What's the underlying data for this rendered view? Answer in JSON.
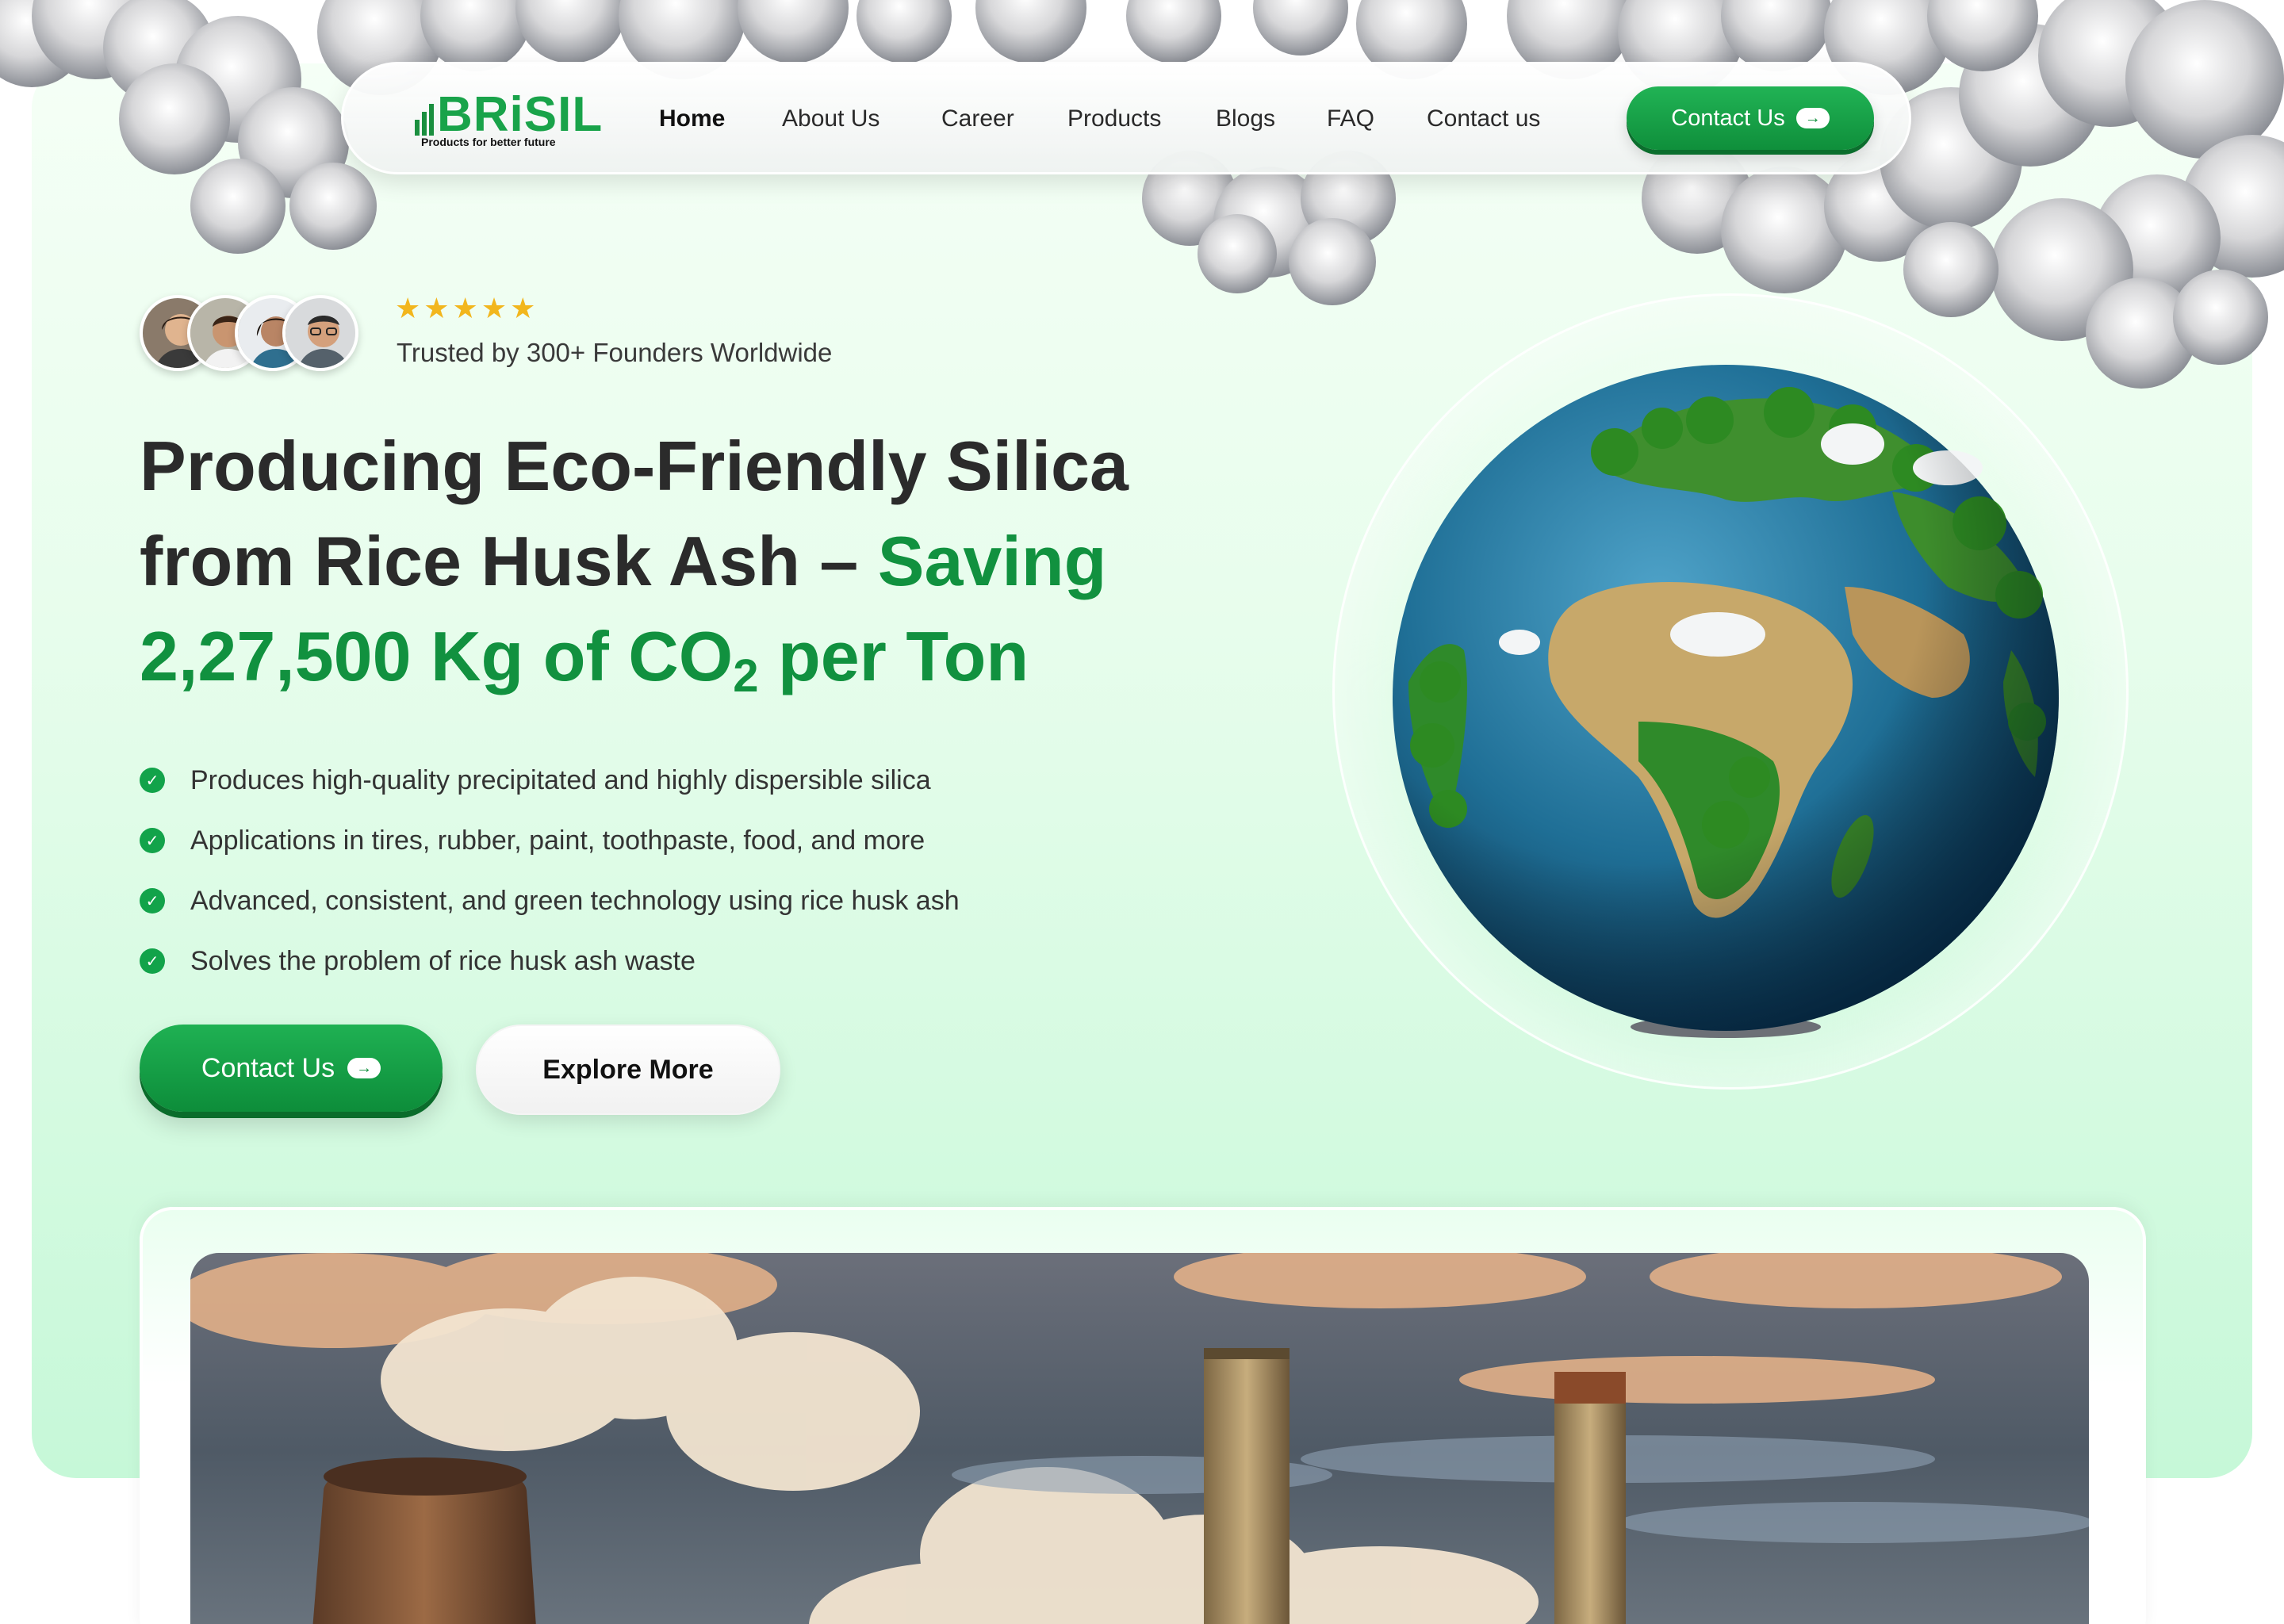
{
  "nav": {
    "logo_text": "BRiSIL",
    "logo_tagline": "Products for better future",
    "links": [
      "Home",
      "About Us",
      "Career",
      "Products",
      "Blogs",
      "FAQ",
      "Contact us"
    ],
    "active": "Home",
    "cta_label": "Contact Us",
    "cta_arrow": "→"
  },
  "trust": {
    "stars": "★★★★★",
    "rating": 5,
    "text": "Trusted by 300+ Founders Worldwide"
  },
  "headline": {
    "line1": "Producing Eco-Friendly Silica",
    "line2_dark": "from Rice Husk Ash –",
    "line2_green": "Saving",
    "line3_green_a": "2,27,500 Kg of CO",
    "line3_sub": "2",
    "line3_green_b": "per Ton"
  },
  "features": [
    "Produces high-quality precipitated and highly dispersible silica",
    "Applications in tires, rubber, paint, toothpaste, food, and more",
    "Advanced, consistent, and green technology using rice husk ash",
    "Solves the problem of rice husk ash waste"
  ],
  "check_glyph": "✓",
  "buttons": {
    "contact_label": "Contact Us",
    "contact_arrow": "→",
    "explore_label": "Explore More"
  },
  "colors": {
    "brand_green": "#11913f",
    "button_green": "#1fb153",
    "star_yellow": "#f2b61d",
    "hero_bg": "#e7fdec"
  },
  "icons": {
    "feature": "check-circle-icon",
    "cta": "arrow-right-icon"
  }
}
